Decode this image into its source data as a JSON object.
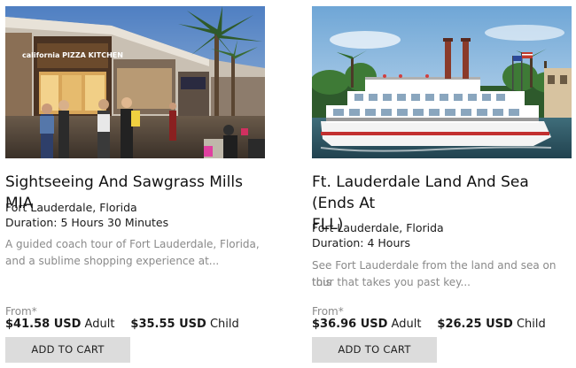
{
  "tours": [
    {
      "image_alt": "Shoppers outside California Pizza Kitchen at Sawgrass Mills",
      "sign_text": "california PIZZA KITCHEN",
      "title": "Sightseeing And Sawgrass Mills MIA",
      "location": "Fort Lauderdale, Florida",
      "duration": "Duration: 5 Hours 30 Minutes",
      "description_1": "A guided coach tour of Fort Lauderdale, Florida,",
      "description_2": "and a sublime shopping experience at...",
      "from_label": "From*",
      "adult_price": "$41.58 USD",
      "adult_label": "Adult",
      "child_price": "$35.55 USD",
      "child_label": "Child",
      "cart_label": "ADD TO CART"
    },
    {
      "image_alt": "Paddlewheel riverboat cruising in Fort Lauderdale",
      "title_1": "Ft. Lauderdale Land And Sea (Ends At",
      "title_2": "FLL)",
      "location": "Fort Lauderdale, Florida",
      "duration": "Duration: 4 Hours",
      "description_1": "See Fort Lauderdale from the land and sea on this",
      "description_2": "tour that takes you past key...",
      "from_label": "From*",
      "adult_price": "$36.96 USD",
      "adult_label": "Adult",
      "child_price": "$26.25 USD",
      "child_label": "Child",
      "cart_label": "ADD TO CART"
    }
  ],
  "colors": {
    "button_bg": "#dcdcdc",
    "muted_text": "#8a8a8a",
    "body_text": "#1a1a1a"
  }
}
